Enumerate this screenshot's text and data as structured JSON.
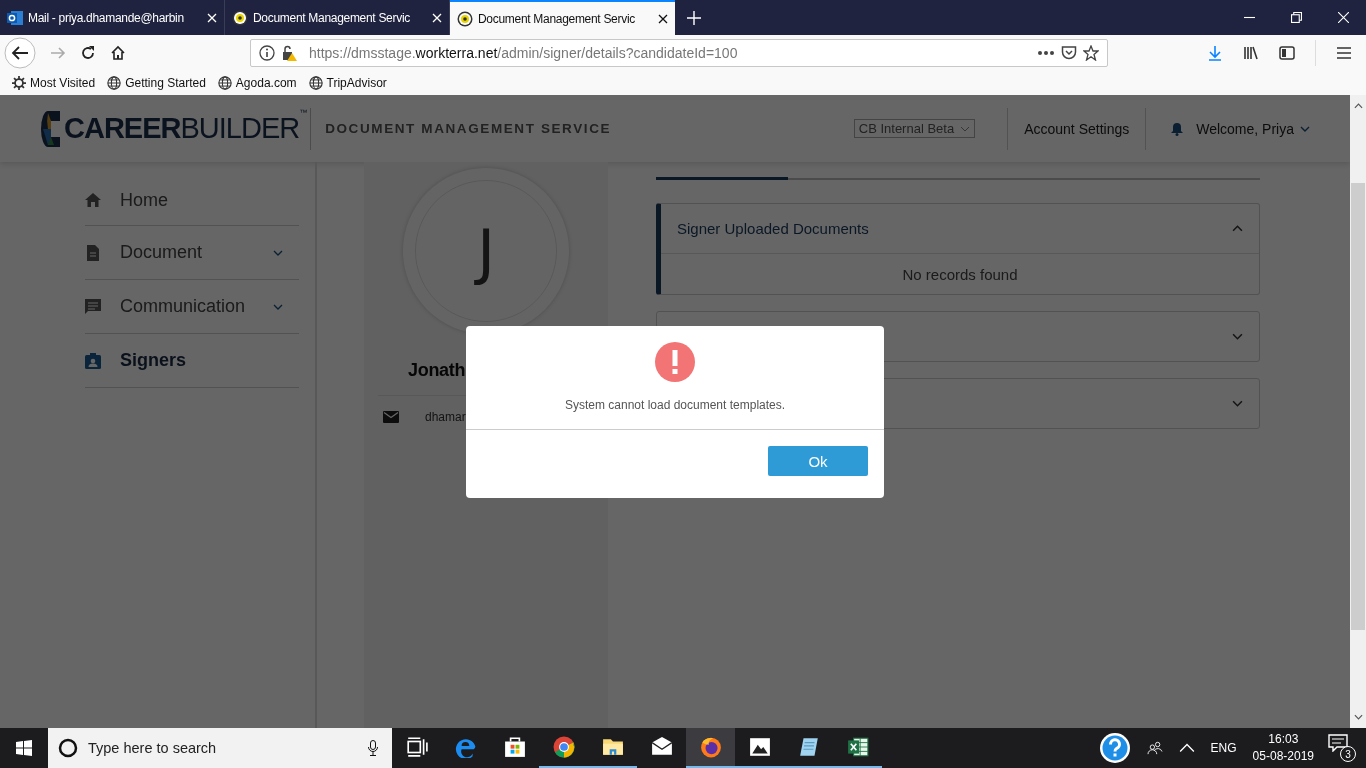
{
  "browser": {
    "tabs": [
      {
        "kind": "mail",
        "title": "Mail - priya.dhamande@harbin",
        "selected": false
      },
      {
        "kind": "dms",
        "title": "Document Management Servic",
        "selected": false
      },
      {
        "kind": "dms",
        "title": "Document Management Servic",
        "selected": true
      }
    ],
    "url": {
      "prefix": "https://dmsstage.",
      "domain": "workterra.net",
      "path": "/admin/signer/details?candidateId=100"
    },
    "bookmarks": [
      {
        "kind": "gear",
        "label": "Most Visited"
      },
      {
        "kind": "globe",
        "label": "Getting Started"
      },
      {
        "kind": "globe",
        "label": "Agoda.com"
      },
      {
        "kind": "globe",
        "label": "TripAdvisor"
      }
    ]
  },
  "header": {
    "logo_bold": "CAREER",
    "logo_light": "BUILDER",
    "logo_mark": "™",
    "service": "DOCUMENT MANAGEMENT SERVICE",
    "org_select": "CB Internal Beta",
    "account_settings": "Account Settings",
    "welcome": "Welcome, Priya"
  },
  "sidebar": {
    "items": [
      {
        "kind": "home",
        "label": "Home",
        "expandable": false,
        "selected": false
      },
      {
        "kind": "document",
        "label": "Document",
        "expandable": true,
        "selected": false
      },
      {
        "kind": "chat",
        "label": "Communication",
        "expandable": true,
        "selected": false
      },
      {
        "kind": "badge",
        "label": "Signers",
        "expandable": false,
        "selected": true
      }
    ]
  },
  "profile": {
    "initial": "J",
    "name": "Jonath",
    "email": "dhamar"
  },
  "accordions": [
    {
      "title": "Signer Uploaded Documents",
      "expanded": true,
      "body": "No records found"
    },
    {
      "expanded": false
    },
    {
      "expanded": false
    }
  ],
  "dialog": {
    "message": "System cannot load document templates.",
    "button": "Ok"
  },
  "taskbar": {
    "search_placeholder": "Type here to search",
    "apps": [
      {
        "kind": "taskview",
        "running": false,
        "active": false
      },
      {
        "kind": "edge",
        "running": false,
        "active": false
      },
      {
        "kind": "store",
        "running": false,
        "active": false
      },
      {
        "kind": "chrome",
        "running": true,
        "active": false
      },
      {
        "kind": "explorer",
        "running": true,
        "active": false
      },
      {
        "kind": "mail",
        "running": false,
        "active": false
      },
      {
        "kind": "firefox",
        "running": true,
        "active": true
      },
      {
        "kind": "photos",
        "running": true,
        "active": false
      },
      {
        "kind": "notepad",
        "running": true,
        "active": false
      },
      {
        "kind": "excel",
        "running": true,
        "active": false
      }
    ],
    "language": "ENG",
    "time": "16:03",
    "date": "05-08-2019",
    "notifications": "3"
  }
}
